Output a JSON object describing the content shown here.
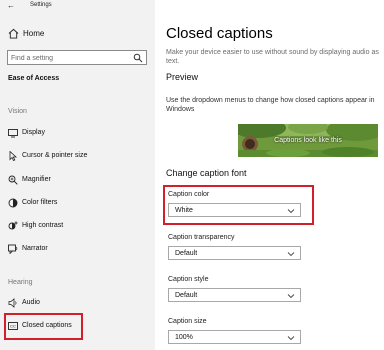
{
  "window": {
    "title": "Settings",
    "back_icon": "back-arrow-icon"
  },
  "sidebar": {
    "home_label": "Home",
    "search_placeholder": "Find a setting",
    "section_title": "Ease of Access",
    "groups": [
      {
        "label": "Vision",
        "items": [
          {
            "label": "Display",
            "icon": "display-icon"
          },
          {
            "label": "Cursor & pointer size",
            "icon": "cursor-icon"
          },
          {
            "label": "Magnifier",
            "icon": "magnifier-icon"
          },
          {
            "label": "Color filters",
            "icon": "color-filters-icon"
          },
          {
            "label": "High contrast",
            "icon": "high-contrast-icon"
          },
          {
            "label": "Narrator",
            "icon": "narrator-icon"
          }
        ]
      },
      {
        "label": "Hearing",
        "items": [
          {
            "label": "Audio",
            "icon": "audio-icon"
          },
          {
            "label": "Closed captions",
            "icon": "closed-captions-icon",
            "highlighted": true
          }
        ]
      }
    ]
  },
  "main": {
    "title": "Closed captions",
    "description": "Make your device easier to use without sound by displaying audio as text.",
    "preview_heading": "Preview",
    "preview_description": "Use the dropdown menus to change how closed captions appear in Windows",
    "preview_caption": "Captions look like this",
    "change_heading": "Change caption font",
    "fields": [
      {
        "label": "Caption color",
        "value": "White",
        "highlighted": true
      },
      {
        "label": "Caption transparency",
        "value": "Default"
      },
      {
        "label": "Caption style",
        "value": "Default"
      },
      {
        "label": "Caption size",
        "value": "100%"
      }
    ]
  },
  "colors": {
    "highlight": "#d1202a",
    "sidebar_bg": "#f2f2f2"
  }
}
